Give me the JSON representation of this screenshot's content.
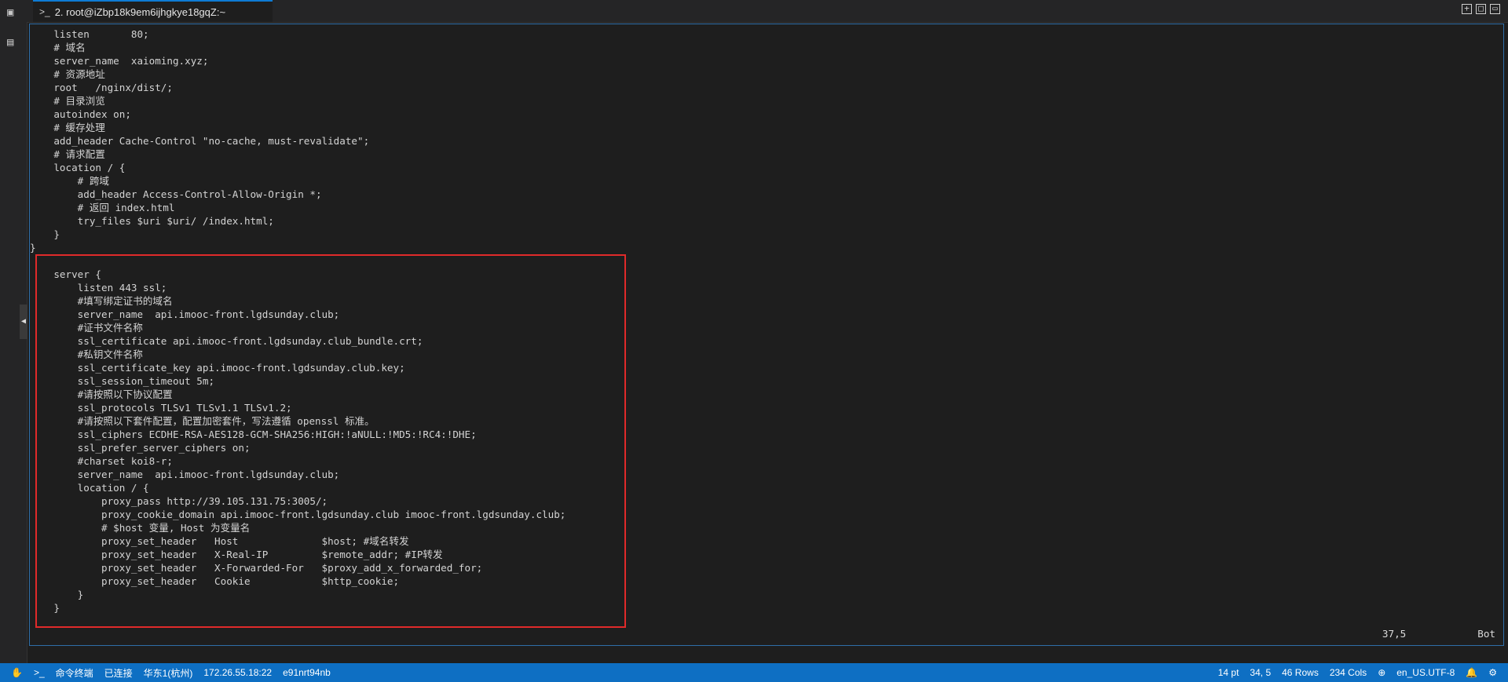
{
  "tab": {
    "prompt": ">_",
    "title": "2. root@iZbp18k9em6ijhgkye18gqZ:~"
  },
  "window_controls": [
    "+",
    "□",
    "▭"
  ],
  "terminal_lines": [
    "    listen       80;",
    "    # 域名",
    "    server_name  xaioming.xyz;",
    "    # 资源地址",
    "    root   /nginx/dist/;",
    "    # 目录浏览",
    "    autoindex on;",
    "    # 缓存处理",
    "    add_header Cache-Control \"no-cache, must-revalidate\";",
    "    # 请求配置",
    "    location / {",
    "        # 跨域",
    "        add_header Access-Control-Allow-Origin *;",
    "        # 返回 index.html",
    "        try_files $uri $uri/ /index.html;",
    "    }",
    "}",
    "",
    "    server {",
    "        listen 443 ssl;",
    "        #填写绑定证书的域名",
    "        server_name  api.imooc-front.lgdsunday.club;",
    "        #证书文件名称",
    "        ssl_certificate api.imooc-front.lgdsunday.club_bundle.crt;",
    "        #私钥文件名称",
    "        ssl_certificate_key api.imooc-front.lgdsunday.club.key;",
    "        ssl_session_timeout 5m;",
    "        #请按照以下协议配置",
    "        ssl_protocols TLSv1 TLSv1.1 TLSv1.2;",
    "        #请按照以下套件配置，配置加密套件，写法遵循 openssl 标准。",
    "        ssl_ciphers ECDHE-RSA-AES128-GCM-SHA256:HIGH:!aNULL:!MD5:!RC4:!DHE;",
    "        ssl_prefer_server_ciphers on;",
    "        #charset koi8-r;",
    "        server_name  api.imooc-front.lgdsunday.club;",
    "        location / {",
    "            proxy_pass http://39.105.131.75:3005/;",
    "            proxy_cookie_domain api.imooc-front.lgdsunday.club imooc-front.lgdsunday.club;",
    "            # $host 变量, Host 为变量名",
    "            proxy_set_header   Host              $host; #域名转发",
    "            proxy_set_header   X-Real-IP         $remote_addr; #IP转发",
    "            proxy_set_header   X-Forwarded-For   $proxy_add_x_forwarded_for;",
    "            proxy_set_header   Cookie            $http_cookie;",
    "        }",
    "    }"
  ],
  "vim_status": {
    "position": "37,5",
    "scroll": "Bot"
  },
  "statusbar": {
    "left": [
      "命令终端",
      "已连接",
      "华东1(杭州)",
      "172.26.55.18:22",
      "e91nrt94nb"
    ],
    "font_size": "14 pt",
    "cursor": "34, 5",
    "rows": "46 Rows",
    "cols": "234 Cols",
    "encoding": "en_US.UTF-8"
  },
  "colors": {
    "accent": "#0e6fc3",
    "highlight_box": "#e02a2a"
  }
}
